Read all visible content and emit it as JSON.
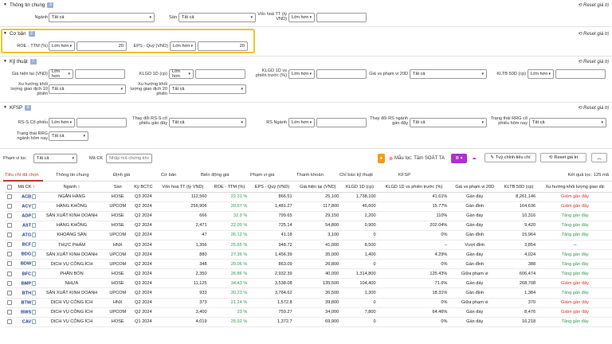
{
  "sections": {
    "general": {
      "title": "Thông tin chung",
      "badge": "3",
      "reset": "Reset giá trị"
    },
    "basic": {
      "title": "Cơ bản",
      "badge": "2",
      "reset": "Reset giá trị"
    },
    "technical": {
      "title": "Kỹ thuật",
      "badge": "7",
      "reset": "Reset giá trị"
    },
    "kfsp": {
      "title": "KFSP",
      "badge": "6",
      "reset": "Reset giá trị"
    }
  },
  "general": {
    "industry_label": "Ngành",
    "industry_value": "Tất cả",
    "exchange_label": "Sàn",
    "exchange_value": "Tất cả",
    "cap_label": "Vốn hoá TT (tỷ VND)",
    "cap_op": "Lớn hơn",
    "cap_value": ""
  },
  "basic": {
    "roe_label": "ROE - TTM (%)",
    "roe_op": "Lớn hơn",
    "roe_value": "20",
    "eps_label": "EPS - Quý (VND)",
    "eps_op": "Lớn hơn",
    "eps_value": "20"
  },
  "technical": {
    "price_label": "Giá hiện tại (VND)",
    "price_op": "Lớn hơn",
    "vol1d_label": "KLGD 1D (cp)",
    "vol1d_op": "Lớn hơn",
    "vol1dvs_label": "KLGD 1D vs phiên trước (%)",
    "vol1dvs_op": "Lớn hơn",
    "range20_label": "Giá vs phạm vi 20D",
    "range20_value": "Tất cả",
    "vol50_label": "KLTB 50D (cp)",
    "vol50_op": "Lớn hơn",
    "trend_label": "Xu hướng khối lượng giao dịch 10 phiên",
    "trend_value": "Tất cả",
    "trend20_label": "Xu hướng khối lượng giao dịch 20 phiên",
    "trend20_value": "Tất cả"
  },
  "kfsp": {
    "rs_label": "RS-S Cổ phiếu",
    "rs_op": "Lớn hơn",
    "rschg_label": "Thay đổi RS-S cổ phiếu gần đây",
    "rschg_value": "Tất cả",
    "rsind_label": "RS Ngành",
    "rsind_op": "Lớn hơn",
    "rsindchg_label": "Thay đổi RS ngành gần đây",
    "rsindchg_value": "Tất cả",
    "rrg_label": "Trạng thái RRG cổ phiếu hôm nay",
    "rrg_value": "Tất cả",
    "rrgind_label": "Trạng thái RRG ngành hôm nay",
    "rrgind_value": "Tất cả"
  },
  "toolbar": {
    "scope_label": "Phạm vi lọc",
    "scope_value": "Tất cả",
    "code_label": "Mã CK",
    "code_placeholder": "Nhập mã chứng khoán",
    "template_label": "Mẫu lọc: Tầm SOÁT TA",
    "customize": "Tuỳ chỉnh tiêu chí",
    "reset": "Reset giá trị"
  },
  "tabs": [
    "Tiêu chí đã chọn",
    "Thông tin chung",
    "Định giá",
    "Cơ bản",
    "Biến động giá",
    "Phạm vi giá",
    "Thanh khoản",
    "Chỉ báo kỹ thuật",
    "KFSP"
  ],
  "result_count": "Kết quả lọc: 125 mã",
  "columns": [
    "Mã CK",
    "Ngành",
    "Sàn",
    "Kỳ BCTC",
    "Vốn hoá TT (tỷ VND)",
    "ROE - TTM (%)",
    "EPS - Quý (VND)",
    "Giá hiện tại (VND)",
    "KLGD 1D (cp)",
    "KLGD 1D vs phiên trước (%)",
    "Giá vs phạm vi 20D",
    "KLTB 50D (cp)",
    "Xu hướng khối lượng giao dịc"
  ],
  "rows": [
    [
      "ACB",
      "NGÂN HÀNG",
      "HOSE",
      "Q3 2024",
      "112,560",
      "22.31 %",
      "866.51",
      "25,100",
      "1,738,100",
      "41.61%",
      "Gần đáy",
      "8,261,146",
      "Giảm gần đây"
    ],
    [
      "ACV",
      "HÀNG KHÔNG",
      "UPCOM",
      "Q2 2024",
      "256,906",
      "20.57 %",
      "1,481.27",
      "117,800",
      "46,600",
      "15.77%",
      "Gần đỉnh",
      "164,636",
      "Giảm gần đây"
    ],
    [
      "ADP",
      "SẢN XUẤT KINH DOANH",
      "HOSE",
      "Q2 2024",
      "666",
      "32.9 %",
      "799.65",
      "29,150",
      "2,200",
      "110%",
      "Gần đáy",
      "10,316",
      "Tăng gần đây"
    ],
    [
      "AST",
      "HÀNG KHÔNG",
      "HOSE",
      "Q2 2024",
      "2,471",
      "22.09 %",
      "725.14",
      "54,800",
      "9,900",
      "202.04%",
      "Gần đáy",
      "9,420",
      "Tăng gần đây"
    ],
    [
      "ATG",
      "KHOÁNG SẢN",
      "UPCOM",
      "Q2 2024",
      "47",
      "26.12 %",
      "41.18",
      "3,100",
      "0",
      "0%",
      "Gần đỉnh",
      "15,964",
      "Tăng gần đây"
    ],
    [
      "BCF",
      "THỰC PHẨM",
      "HNX",
      "Q3 2024",
      "1,356",
      "25.65 %",
      "948.72",
      "41,000",
      "8,500",
      "--",
      "Vượt đỉnh",
      "3,854",
      "--"
    ],
    [
      "BDG",
      "SẢN XUẤT KINH DOANH",
      "UPCOM",
      "Q2 2024",
      "880",
      "27.36 %",
      "1,456.39",
      "35,000",
      "1,400",
      "4.29%",
      "Gần đáy",
      "4,024",
      "Tăng gần đây"
    ],
    [
      "BDW",
      "DỊCH VỤ CÔNG ÍCH",
      "UPCOM",
      "Q2 2024",
      "348",
      "20.06 %",
      "863.09",
      "26,800",
      "0",
      "0%",
      "Gần đỉnh",
      "388",
      "Tăng gần đây"
    ],
    [
      "BFC",
      "PHÂN BÓN",
      "HOSE",
      "Q2 2024",
      "2,350",
      "26.86 %",
      "2,932.39",
      "40,000",
      "1,314,800",
      "125.43%",
      "Giữa phạm vi",
      "606,474",
      "Tăng gần đây"
    ],
    [
      "BMP",
      "NHỰA",
      "HOSE",
      "Q3 2024",
      "11,125",
      "34.43 %",
      "3,538.08",
      "135,500",
      "104,400",
      "71.6%",
      "Gần đáy",
      "268,708",
      "Giảm gần đây"
    ],
    [
      "BTH",
      "SẢN XUẤT KINH DOANH",
      "UPCOM",
      "Q2 2024",
      "933",
      "30.23 %",
      "3,764.62",
      "36,500",
      "1,300",
      "18.31%",
      "Gần đỉnh",
      "1,384",
      "Tăng gần đây"
    ],
    [
      "BTW",
      "DỊCH VỤ CÔNG ÍCH",
      "HNX",
      "Q2 2024",
      "373",
      "21.24 %",
      "1,572.8",
      "39,800",
      "0",
      "0%",
      "Giữa phạm vi",
      "370",
      "Giảm gần đây"
    ],
    [
      "BWS",
      "DỊCH VỤ CÔNG ÍCH",
      "UPCOM",
      "Q2 2024",
      "3,400",
      "23 %",
      "759.27",
      "34,000",
      "7,800",
      "64.46%",
      "Gần đáy",
      "8,476",
      "Giảm gần đây"
    ],
    [
      "CAV",
      "DỊCH VỤ CÔNG ÍCH",
      "HOSE",
      "Q1 2024",
      "4,019",
      "25.02 %",
      "1,372.7",
      "69,900",
      "0",
      "0%",
      "Gần đáy",
      "16,218",
      "Tăng gần đây"
    ]
  ],
  "colors": {
    "highlight": "#f1c232",
    "accent": "#c0392b",
    "purple": "#b02fd1",
    "orange": "#f39c12",
    "positive": "#2e9a52",
    "negative": "#d9342b"
  }
}
